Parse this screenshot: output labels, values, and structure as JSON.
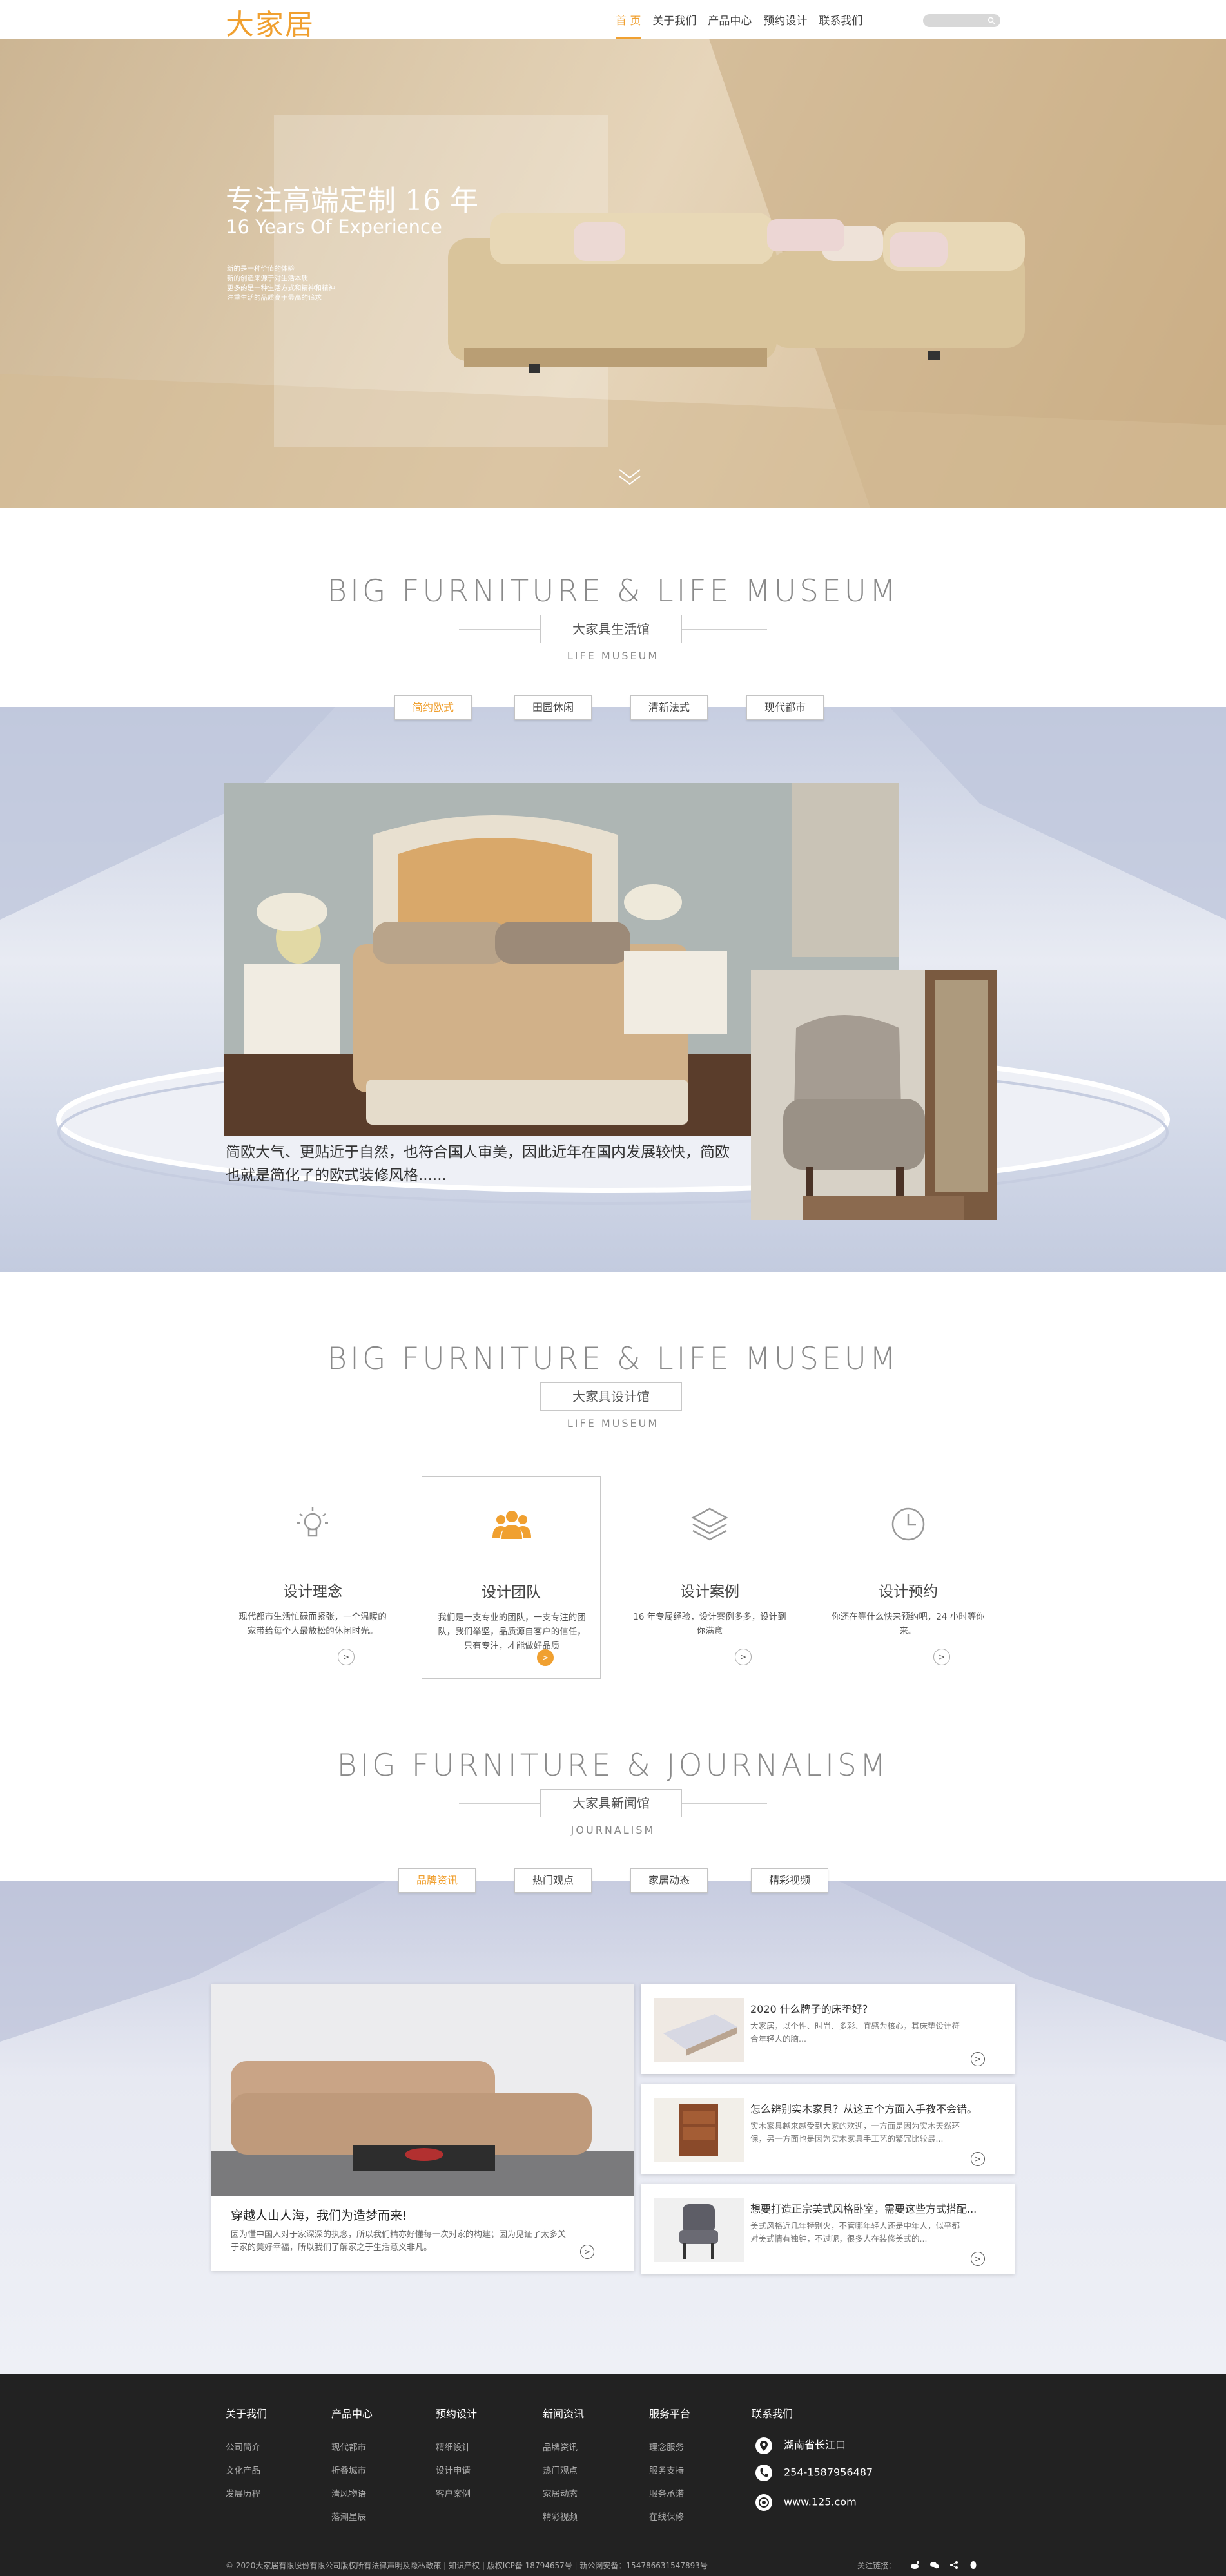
{
  "header": {
    "logo": "大家居",
    "nav": [
      "首 页",
      "关于我们",
      "产品中心",
      "预约设计",
      "联系我们"
    ],
    "active_nav": 0,
    "search_placeholder": ""
  },
  "hero": {
    "title": "专注高端定制 16 年",
    "subtitle": "16 Years Of Experience",
    "desc": [
      "新的是一种价值的体验",
      "新的创造来源于对生活本质",
      "更多的是一种生活方式和精神和精神",
      "注重生活的品质高于最高的追求"
    ],
    "colors": {
      "accent": "#f0a030",
      "hero": "#dcc9ab"
    }
  },
  "section1": {
    "title_en": "BIG FURNITURE  &  LIFE MUSEUM",
    "title_cn": "大家具生活馆",
    "subtitle_en": "LIFE MUSEUM",
    "tabs": [
      "简约欧式",
      "田园休闲",
      "清新法式",
      "现代都市"
    ],
    "active_tab": 0,
    "caption": "简欧大气、更贴近于自然，也符合国人审美，因此近年在国内发展较快，简欧也就是简化了的欧式装修风格......"
  },
  "section2": {
    "title_en": "BIG FURNITURE  &  LIFE MUSEUM",
    "title_cn": "大家具设计馆",
    "subtitle_en": "LIFE MUSEUM",
    "services": [
      {
        "name": "设计理念",
        "icon": "lightbulb-icon",
        "desc": "现代都市生活忙碌而紧张，一个温暖的家带给每个人最放松的休闲时光。"
      },
      {
        "name": "设计团队",
        "icon": "team-icon",
        "desc": "我们是一支专业的团队，一支专注的团队，我们举坚，品质源自客户的信任，只有专注，才能做好品质"
      },
      {
        "name": "设计案例",
        "icon": "layers-icon",
        "desc": "16 年专属经验，设计案例多多，设计到你满意"
      },
      {
        "name": "设计预约",
        "icon": "clock-icon",
        "desc": "你还在等什么快来预约吧，24 小时等你来。"
      }
    ],
    "active_service": 1
  },
  "section3": {
    "title_en": "BIG FURNITURE  &  JOURNALISM",
    "title_cn": "大家具新闻馆",
    "subtitle_en": "JOURNALISM",
    "tabs": [
      "品牌资讯",
      "热门观点",
      "家居动态",
      "精彩视频"
    ],
    "active_tab": 0,
    "main_news": {
      "title": "穿越人山人海，我们为造梦而来!",
      "desc": "因为懂中国人对于家深深的执念，所以我们精亦好懂每一次对家的构建；因为见证了太多关于家的美好幸福，所以我们了解家之于生活意义非凡。"
    },
    "news": [
      {
        "title": "2020 什么牌子的床垫好？",
        "desc": "大家居，以个性、时尚、多彩、宜感为核心，其床垫设计符合年轻人的脑..."
      },
      {
        "title": "怎么辨别实木家具？从这五个方面入手教不会错。",
        "desc": "实木家具越来越受到大家的欢迎，一方面是因为实木天然环保，另一方面也是因为实木家具手工艺的繁冗比较最..."
      },
      {
        "title": "想要打造正宗美式风格卧室，需要这些方式搭配...",
        "desc": "美式风格近几年特别火，不管哪年轻人还是中年人，似乎都对美式情有独钟，不过呢，很多人在装修美式的..."
      }
    ]
  },
  "footer": {
    "columns": [
      {
        "title": "关于我们",
        "links": [
          "公司简介",
          "文化产品",
          "发展历程"
        ]
      },
      {
        "title": "产品中心",
        "links": [
          "现代都市",
          "折叠城市",
          "清风物语",
          "落潮星辰"
        ]
      },
      {
        "title": "预约设计",
        "links": [
          "精细设计",
          "设计申请",
          "客户案例"
        ]
      },
      {
        "title": "新闻资讯",
        "links": [
          "品牌资讯",
          "热门观点",
          "家居动态",
          "精彩视频"
        ]
      },
      {
        "title": "服务平台",
        "links": [
          "理念服务",
          "服务支持",
          "服务承诺",
          "在线保修"
        ]
      }
    ],
    "contact_title": "联系我们",
    "contact": [
      {
        "icon": "location-icon",
        "text": "湖南省长江口"
      },
      {
        "icon": "phone-icon",
        "text": "254-1587956487"
      },
      {
        "icon": "web-icon",
        "text": "www.125.com"
      }
    ],
    "copyright": "© 2020大家居有限股份有限公司版权所有法律声明及隐私政策 | 知识产权 | 版权ICP备 18794657号 | 新公网安备：154786631547893号",
    "follow": "关注链接："
  }
}
